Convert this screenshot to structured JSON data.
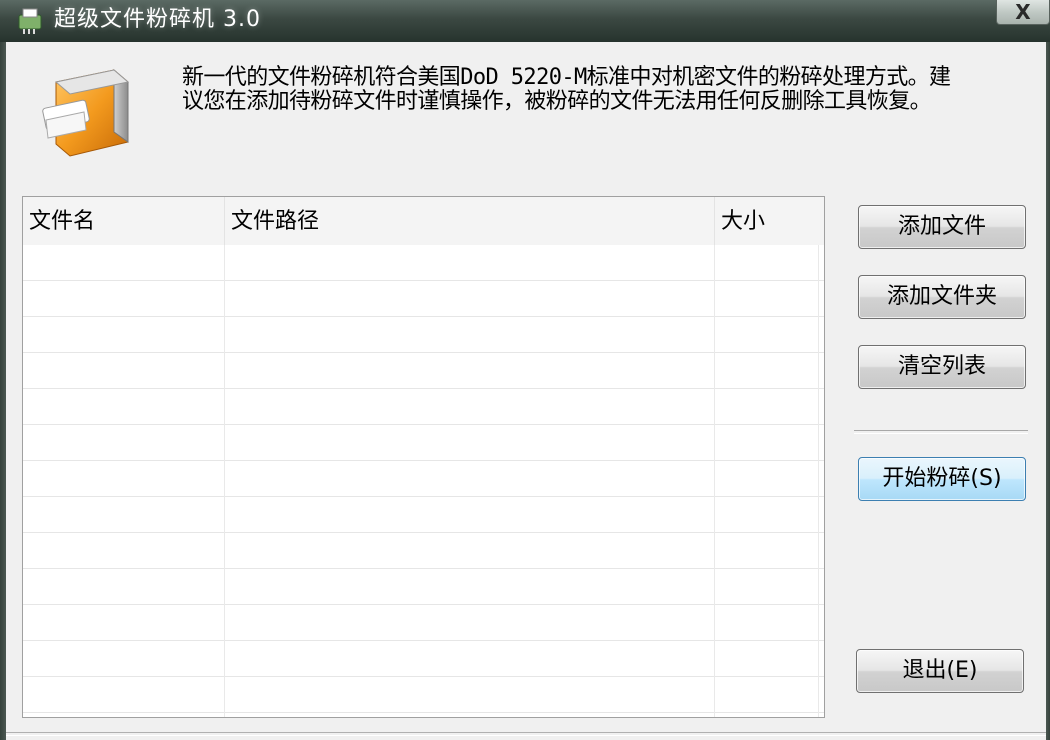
{
  "window": {
    "title": "超级文件粉碎机  3.0",
    "close_label": "X"
  },
  "header": {
    "description": "新一代的文件粉碎机符合美国DoD 5220-M标准中对机密文件的粉碎处理方式。建议您在添加待粉碎文件时谨慎操作，被粉碎的文件无法用任何反删除工具恢复。"
  },
  "file_list": {
    "columns": [
      "文件名",
      "文件路径",
      "大小"
    ],
    "rows": []
  },
  "buttons": {
    "add_file": "添加文件",
    "add_folder": "添加文件夹",
    "clear_list": "清空列表",
    "start_shred": "开始粉碎(S)",
    "exit": "退出(E)"
  },
  "icons": {
    "app_icon": "shredder-icon",
    "logo": "shredder-logo"
  },
  "colors": {
    "title_bar": "#26332d",
    "primary_button": "#bee6fd",
    "logo_orange": "#f39a1e"
  }
}
